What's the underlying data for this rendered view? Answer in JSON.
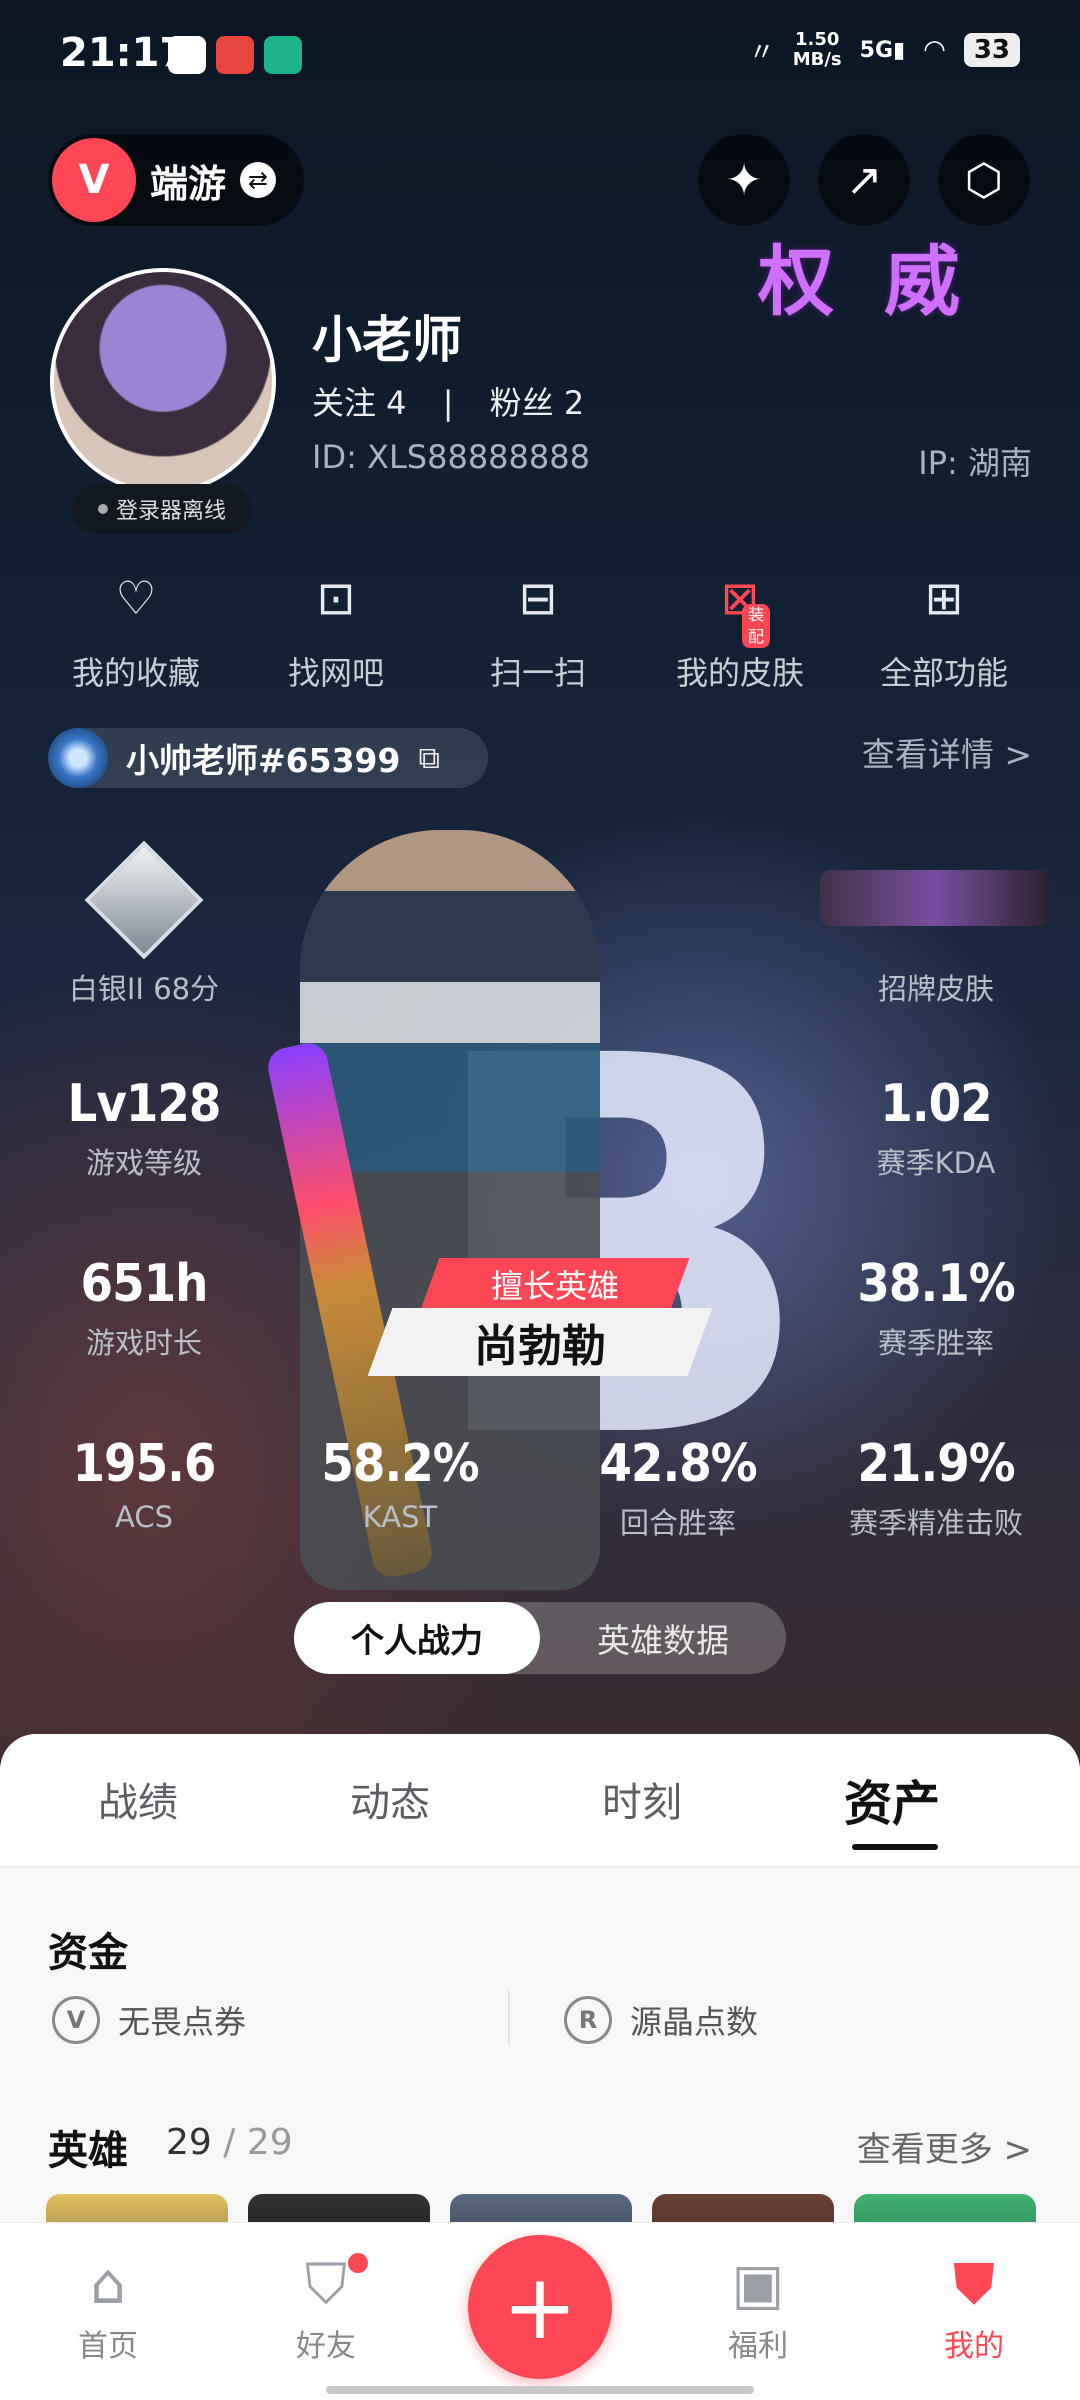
{
  "status_bar": {
    "time": "21:17",
    "net_speed_value": "1.50",
    "net_speed_unit": "MB/s",
    "signal": "5G",
    "battery": "33"
  },
  "header": {
    "game_name": "端游"
  },
  "profile": {
    "nickname": "小老师",
    "follow_text": "关注 4",
    "fans_text": "粉丝 2",
    "separator": "|",
    "id_text": "ID: XLS88888888",
    "ip_text": "IP: 湖南",
    "offline_text": "登录器离线"
  },
  "functions": [
    {
      "label": "我的收藏",
      "icon": "heart-icon"
    },
    {
      "label": "找网吧",
      "icon": "monitor-icon"
    },
    {
      "label": "扫一扫",
      "icon": "scan-icon"
    },
    {
      "label": "我的皮肤",
      "icon": "skin-icon",
      "badge": "装配"
    },
    {
      "label": "全部功能",
      "icon": "grid-icon"
    }
  ],
  "riot": {
    "name": "小帅老师#65399",
    "detail_link": "查看详情 >"
  },
  "stats": {
    "rank": "白银II 68分",
    "signature_skin": "招牌皮肤",
    "level_value": "Lv128",
    "level_label": "游戏等级",
    "kda_value": "1.02",
    "kda_label": "赛季KDA",
    "hours_value": "651h",
    "hours_label": "游戏时长",
    "winrate_value": "38.1%",
    "winrate_label": "赛季胜率",
    "acs_value": "195.6",
    "acs_label": "ACS",
    "kast_value": "58.2%",
    "kast_label": "KAST",
    "round_value": "42.8%",
    "round_label": "回合胜率",
    "precise_value": "21.9%",
    "precise_label": "赛季精准击败",
    "grade_letter": "B"
  },
  "hero_banner": {
    "tag": "擅长英雄",
    "name": "尚勃勒"
  },
  "toggle": {
    "active": "个人战力",
    "inactive": "英雄数据"
  },
  "tabs": [
    "战绩",
    "动态",
    "时刻",
    "资产"
  ],
  "assets": {
    "title": "资金",
    "vp_label": "无畏点券",
    "rp_label": "源晶点数",
    "rp_icon_text": "R"
  },
  "heroes": {
    "title": "英雄",
    "owned": "29",
    "total": "/ 29",
    "more_link": "查看更多 >"
  },
  "bottom_nav": {
    "home": "首页",
    "friends": "好友",
    "welfare": "福利",
    "mine": "我的"
  },
  "colors": {
    "accent": "#ff4655",
    "sheet_bg": "#f7f7f8"
  }
}
